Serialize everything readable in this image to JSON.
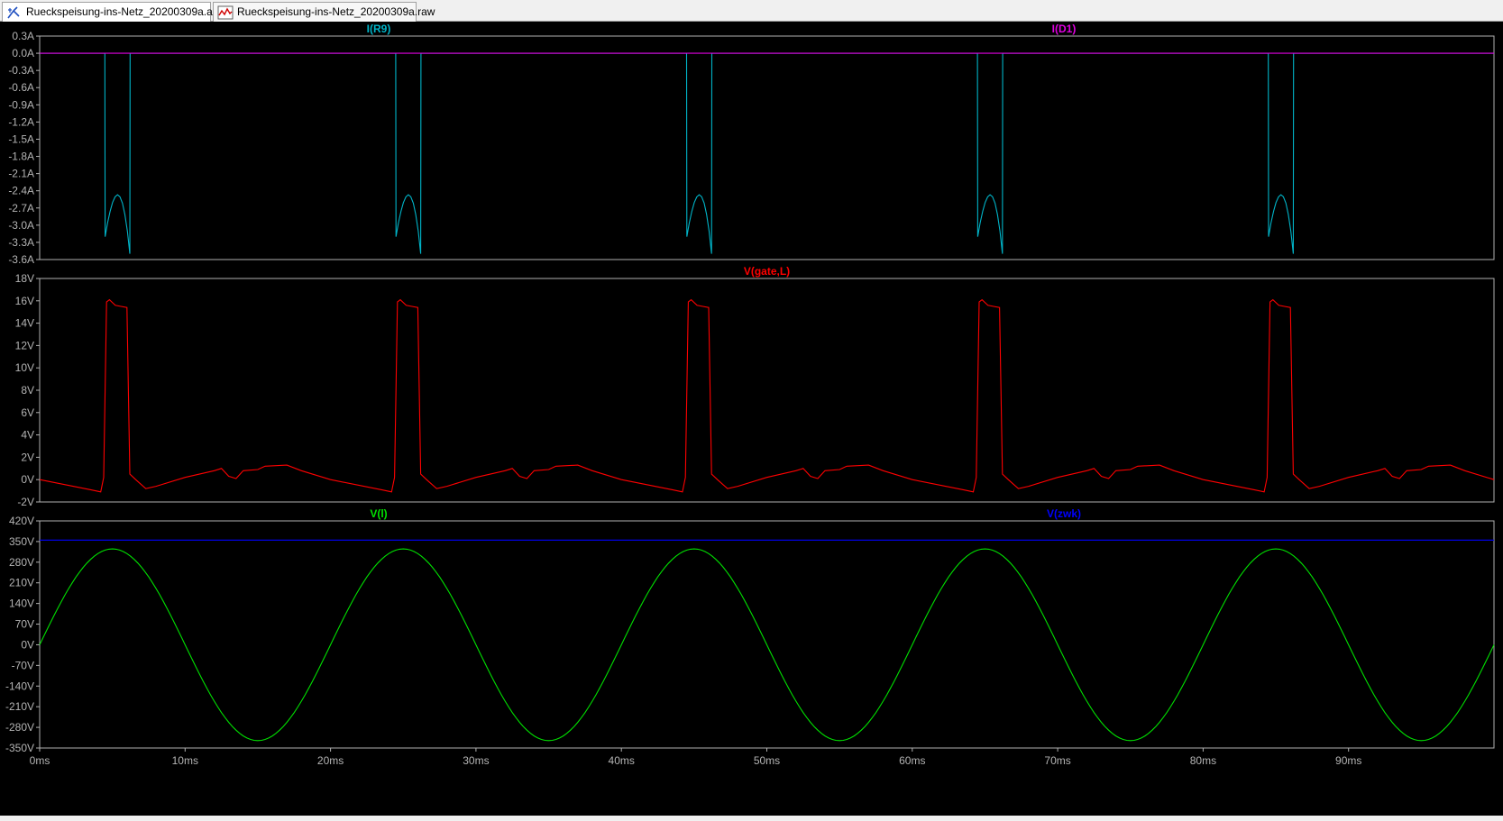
{
  "tabs": [
    {
      "label": "Rueckspeisung-ins-Netz_20200309a.asc",
      "icon": "schematic-icon"
    },
    {
      "label": "Rueckspeisung-ins-Netz_20200309a.raw",
      "icon": "waveform-icon"
    }
  ],
  "chart_data": [
    {
      "type": "line",
      "series": [
        {
          "name": "I(R9)",
          "color": "#00b4c8",
          "pulses_at_ms": [
            5,
            25,
            45,
            65,
            85
          ],
          "pulse_shape": {
            "on_ms": 4.5,
            "off_ms": 6.2,
            "y_start": -3.2,
            "y_peak": -2.55,
            "y_end": -3.5
          },
          "baseline": 0.0
        },
        {
          "name": "I(D1)",
          "color": "#e000e0",
          "constant": 0.0
        }
      ],
      "ylim": [
        -3.6,
        0.3
      ],
      "yticks": [
        "0.3A",
        "0.0A",
        "-0.3A",
        "-0.6A",
        "-0.9A",
        "-1.2A",
        "-1.5A",
        "-1.8A",
        "-2.1A",
        "-2.4A",
        "-2.7A",
        "-3.0A",
        "-3.3A",
        "-3.6A"
      ],
      "xlim": [
        0,
        100
      ]
    },
    {
      "type": "line",
      "series": [
        {
          "name": "V(gate,L)",
          "color": "#ff0000",
          "pulses_at_ms": [
            5,
            25,
            45,
            65,
            85
          ],
          "pulse_shape": {
            "on_ms": 4.5,
            "off_ms": 6.2,
            "v_high": 15.5,
            "v_overshoot": 16.1
          }
        }
      ],
      "ylim": [
        -2,
        18
      ],
      "yticks": [
        "18V",
        "16V",
        "14V",
        "12V",
        "10V",
        "8V",
        "6V",
        "4V",
        "2V",
        "0V",
        "-2V"
      ],
      "xlim": [
        0,
        100
      ]
    },
    {
      "type": "line",
      "series": [
        {
          "name": "V(l)",
          "color": "#00e000",
          "amplitude": 325,
          "frequency_hz": 50
        },
        {
          "name": "V(zwk)",
          "color": "#0000ff",
          "constant": 355
        }
      ],
      "ylim": [
        -350,
        420
      ],
      "yticks": [
        "420V",
        "350V",
        "280V",
        "210V",
        "140V",
        "70V",
        "0V",
        "-70V",
        "-140V",
        "-210V",
        "-280V",
        "-350V"
      ],
      "xlim": [
        0,
        100
      ],
      "xticks": [
        "0ms",
        "10ms",
        "20ms",
        "30ms",
        "40ms",
        "50ms",
        "60ms",
        "70ms",
        "80ms",
        "90ms"
      ]
    }
  ]
}
